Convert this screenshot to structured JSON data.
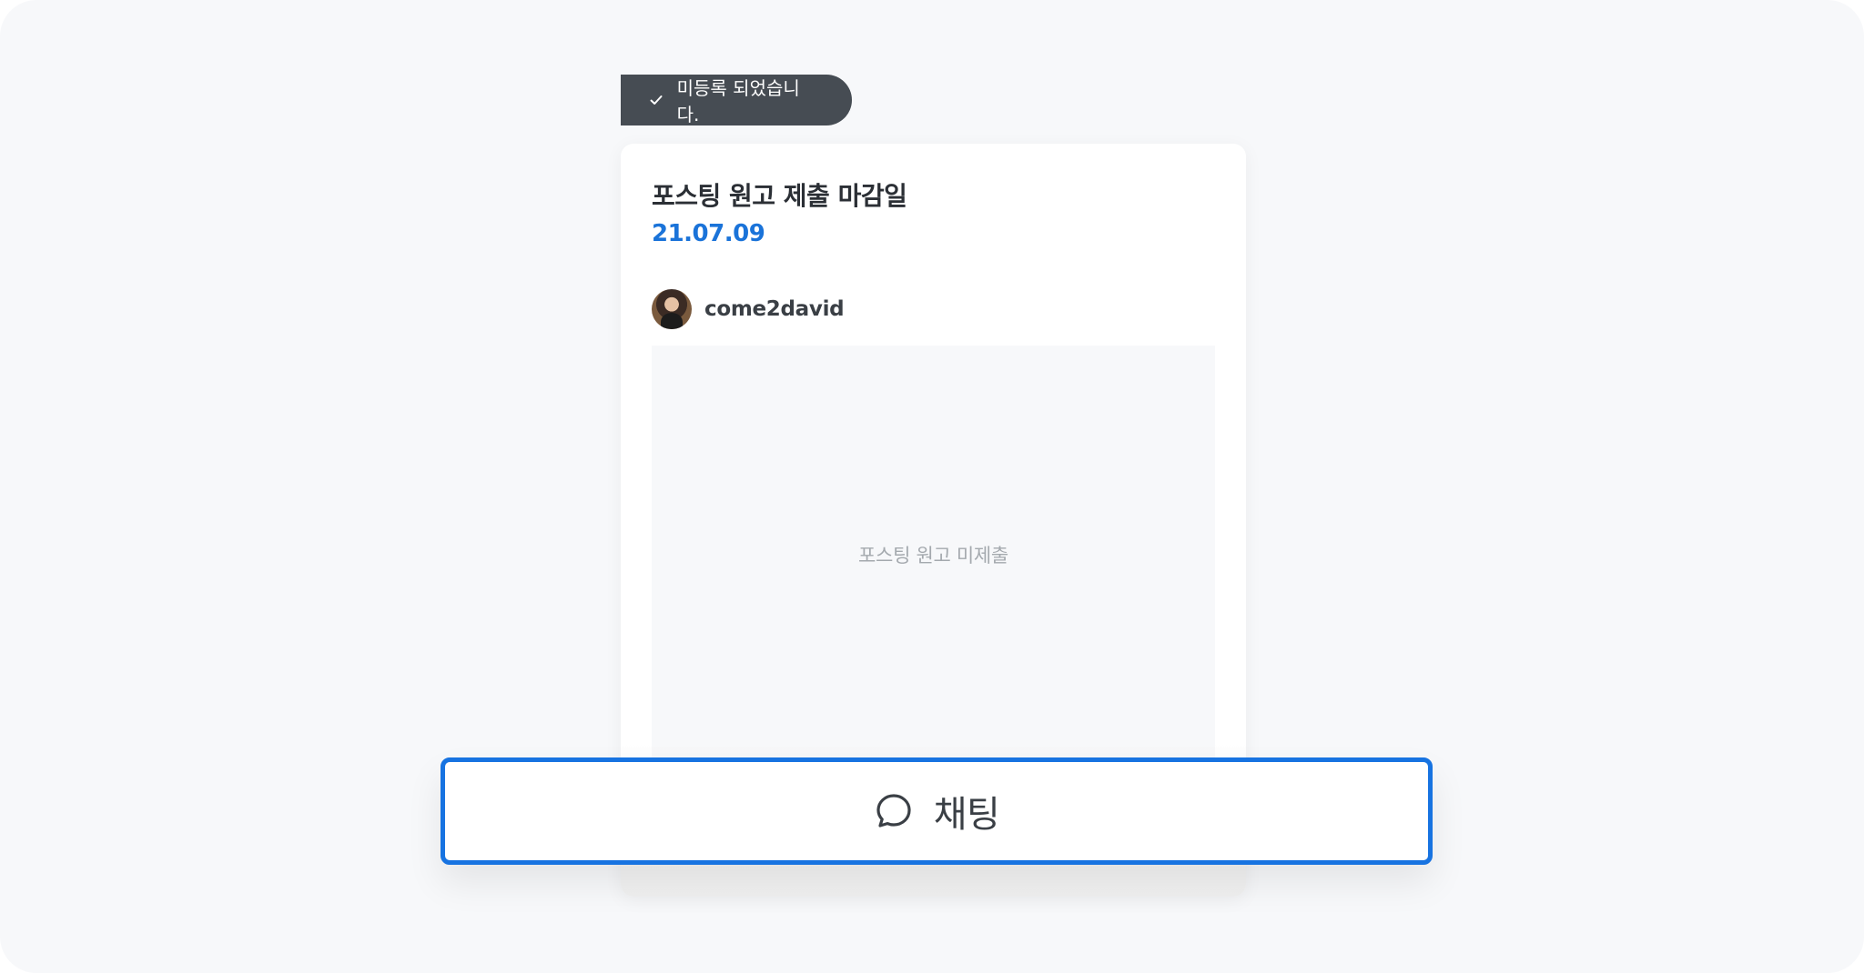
{
  "toast": {
    "icon": "check-icon",
    "message": "미등록 되었습니다."
  },
  "card": {
    "title": "포스팅 원고 제출 마감일",
    "date": "21.07.09",
    "author": {
      "name": "come2david",
      "avatar": "avatar-photo"
    },
    "content_placeholder": "포스팅 원고 미제출"
  },
  "chat_button": {
    "icon": "chat-bubble-icon",
    "label": "채팅"
  },
  "colors": {
    "accent": "#1773e1",
    "date": "#1a73d9",
    "toast_bg": "#464c53",
    "page_bg": "#f7f8fa"
  }
}
